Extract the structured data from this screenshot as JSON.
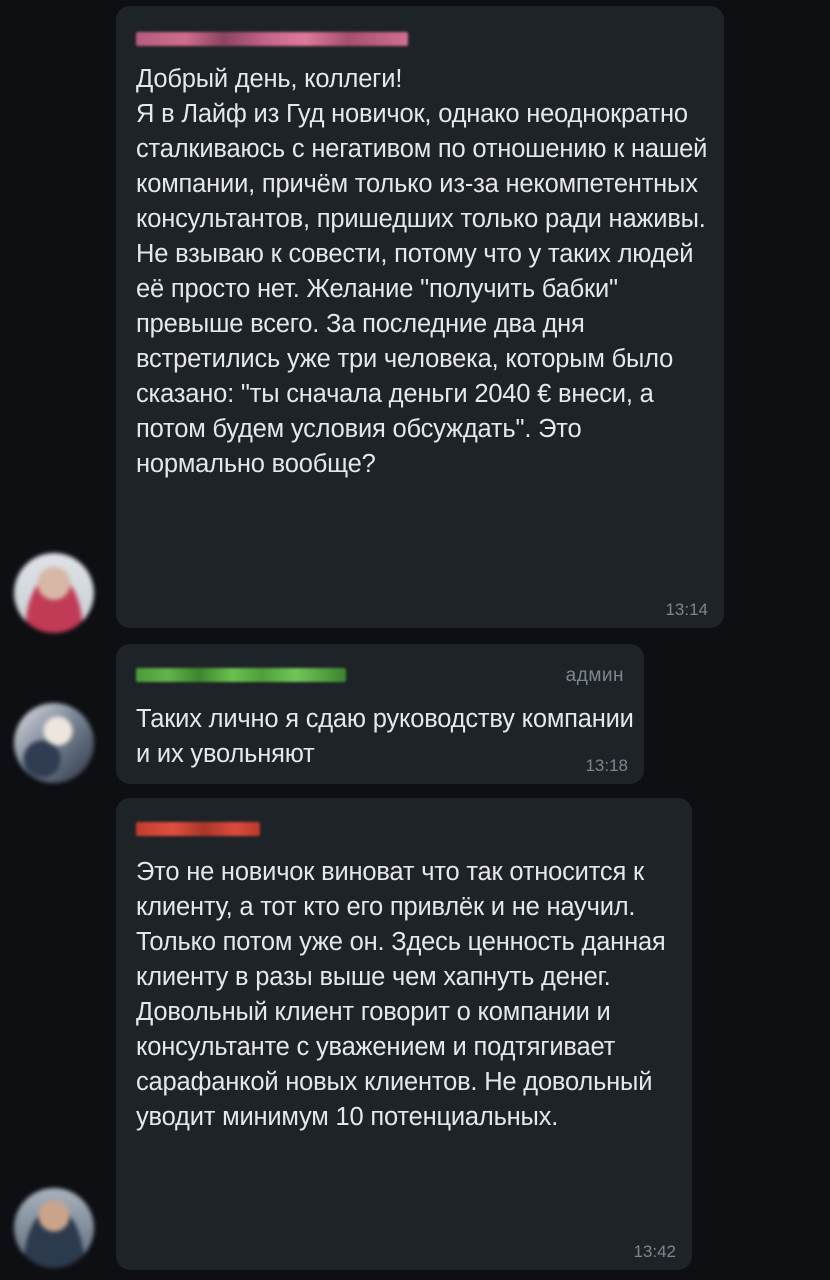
{
  "messages": [
    {
      "text": "Добрый день, коллеги!\nЯ в Лайф из Гуд новичок, однако неоднократно сталкиваюсь с негативом  по отношению к нашей компании, причём только из-за некомпетентных консультантов, пришедших только ради наживы.\nНе взываю к совести, потому что у таких людей её просто нет. Желание \"получить бабки\" превыше всего. За последние два дня встретились уже три человека, которым было сказано: \"ты сначала деньги 2040 € внеси, а потом будем условия обсуждать\". Это нормально вообще?",
      "time": "13:14"
    },
    {
      "role": "админ",
      "text": "Таких лично я сдаю руководству компании и их увольняют",
      "time": "13:18"
    },
    {
      "text": "Это не новичок виноват что так относится к клиенту, а тот кто его привлёк и не научил. Только потом уже он. Здесь ценность данная клиенту в разы выше чем хапнуть денег. Довольный клиент говорит о компании и консультанте с уважением и подтягивает сарафанкой новых клиентов. Не довольный уводит минимум 10 потенциальных.",
      "time": "13:42"
    }
  ],
  "colors": {
    "background": "#0d0f12",
    "bubble": "#1e2328",
    "text": "#e6e7e9",
    "meta": "#7d858e"
  }
}
